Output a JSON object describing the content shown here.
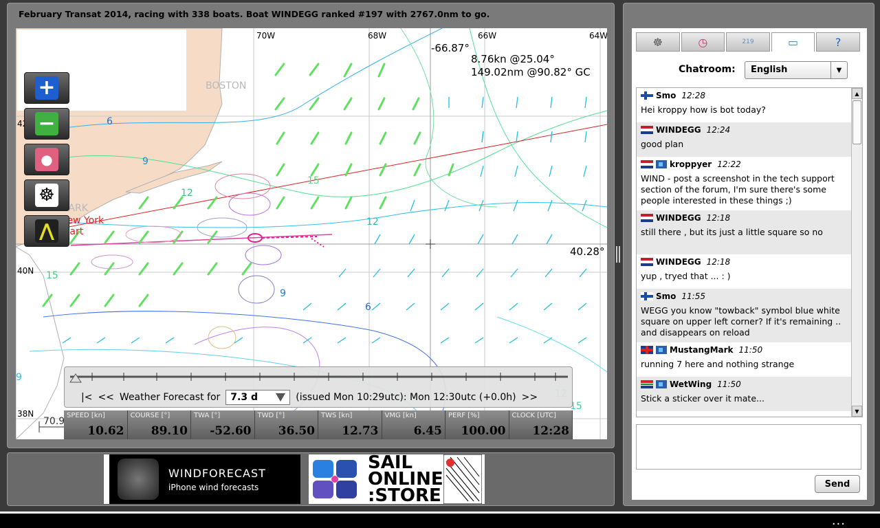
{
  "header": {
    "title": "February Transat 2014, racing with 338 boats. Boat WINDEGG ranked #197 with 2767.0nm to go."
  },
  "map": {
    "lon_ticks": [
      "70W",
      "68W",
      "66W",
      "64W"
    ],
    "lat_ticks": [
      "42N",
      "40N",
      "38N"
    ],
    "cursor": {
      "lon": "-66.87°",
      "speed": "8.76kn @25.04°",
      "dist": "149.02nm @90.82° GC",
      "lat": "40.28°"
    },
    "cities": {
      "boston": "BOSTON",
      "newark": "NEWARK",
      "newyork": "New York",
      "start": "Start"
    },
    "scale_label": "70.9nm",
    "contours": [
      "6",
      "9",
      "12",
      "15",
      "12",
      "9",
      "6",
      "9",
      "12",
      "15",
      "15"
    ],
    "buttons": {
      "zoom_in": "zoom in",
      "zoom_out": "zoom out",
      "center": "center on boat",
      "wheel": "steering",
      "compass": "compass"
    }
  },
  "forecast": {
    "nav_first": "|<",
    "nav_prev": "<<",
    "label": "Weather Forecast for",
    "duration": "7.3 d",
    "issued": "(issued Mon 10:29utc): Mon 12:30utc  (+0.0h)",
    "nav_next": ">>"
  },
  "instruments": [
    {
      "label": "SPEED [kn]",
      "value": "10.62"
    },
    {
      "label": "COURSE [°]",
      "value": "89.10"
    },
    {
      "label": "TWA [°]",
      "value": "-52.60"
    },
    {
      "label": "TWD [°]",
      "value": "36.50"
    },
    {
      "label": "TWS [kn]",
      "value": "12.73"
    },
    {
      "label": "VMG [kn]",
      "value": "6.45"
    },
    {
      "label": "PERF [%]",
      "value": "100.00"
    },
    {
      "label": "CLOCK [UTC]",
      "value": "12:28"
    }
  ],
  "ads": {
    "wind_title": "WINDFORECAST",
    "wind_sub": "iPhone wind forecasts",
    "sail_l1": "SAIL",
    "sail_l2": "ONLINE",
    "sail_l3": ":STORE"
  },
  "chat": {
    "tabs": [
      "settings-icon",
      "clock-icon",
      "ranking-icon",
      "chat-icon",
      "help-icon"
    ],
    "tab_rank_text": "219",
    "room_label": "Chatroom:",
    "language": "English",
    "send_label": "Send",
    "messages": [
      {
        "flag": "fi",
        "user": "Smo",
        "time": "12:28",
        "text": "Hei kroppy how is bot today?",
        "sol": false
      },
      {
        "flag": "nl",
        "user": "WINDEGG",
        "time": "12:24",
        "text": "good plan",
        "sol": false
      },
      {
        "flag": "nl",
        "user": "kroppyer",
        "time": "12:22",
        "text": "WIND - post a screenshot in the tech support section of the forum, I'm sure there's some people interested in these things ;)",
        "sol": true
      },
      {
        "flag": "nl",
        "user": "WINDEGG",
        "time": "12:18",
        "text": "still there , but its just a little square so no",
        "sol": false
      },
      {
        "flag": "nl",
        "user": "WINDEGG",
        "time": "12:18",
        "text": "yup , tryed that ... : )",
        "sol": false
      },
      {
        "flag": "fi",
        "user": "Smo",
        "time": "11:55",
        "text": "WEGG you know \"towback\" symbol blue white square on upper left corner? If it's remaining .. and disappears on reload",
        "sol": false
      },
      {
        "flag": "gb",
        "user": "MustangMark",
        "time": "11:50",
        "text": "running 7 here and nothing strange",
        "sol": true
      },
      {
        "flag": "za",
        "user": "WetWing",
        "time": "11:50",
        "text": "Stick a sticker over it mate...",
        "sol": true
      }
    ]
  },
  "footer": {
    "dots": "..."
  },
  "colors": {
    "land": "#f6dcc6",
    "wind_green": "#5ce060",
    "wind_cyan": "#20c8e0",
    "route": "#e02020",
    "fleet": "#e040a0"
  }
}
